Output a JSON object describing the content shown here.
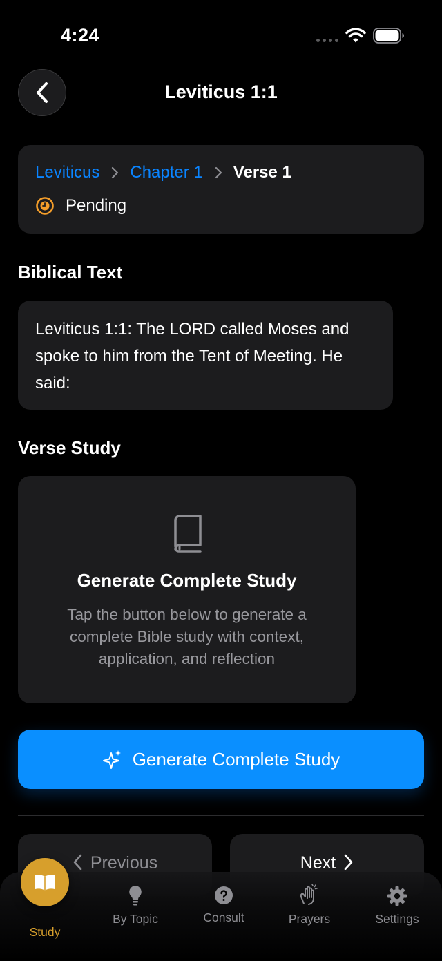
{
  "status_bar": {
    "time": "4:24"
  },
  "header": {
    "title": "Leviticus 1:1"
  },
  "breadcrumb": {
    "book": "Leviticus",
    "chapter": "Chapter 1",
    "verse": "Verse 1",
    "status": "Pending"
  },
  "biblical_text": {
    "section_title": "Biblical Text",
    "verse": "Leviticus 1:1: The LORD called Moses and spoke to him from the Tent of Meeting. He said:"
  },
  "verse_study": {
    "section_title": "Verse Study",
    "icon": "book-icon",
    "heading": "Generate Complete Study",
    "description": "Tap the button below to generate a complete Bible study with context, application, and reflection"
  },
  "generate_button": {
    "label": "Generate Complete Study",
    "icon": "sparkles-icon"
  },
  "pager": {
    "previous": "Previous",
    "next": "Next"
  },
  "tabbar": {
    "items": [
      {
        "label": "Study",
        "icon": "book-open-icon",
        "active": true
      },
      {
        "label": "By Topic",
        "icon": "lightbulb-icon"
      },
      {
        "label": "Consult",
        "icon": "question-circle-icon"
      },
      {
        "label": "Prayers",
        "icon": "praying-hands-icon"
      },
      {
        "label": "Settings",
        "icon": "gear-icon"
      }
    ]
  },
  "colors": {
    "accent_blue": "#0a84ff",
    "pending_orange": "#f59e2a",
    "study_gold": "#d79f2c",
    "card_bg": "#1c1c1e"
  }
}
